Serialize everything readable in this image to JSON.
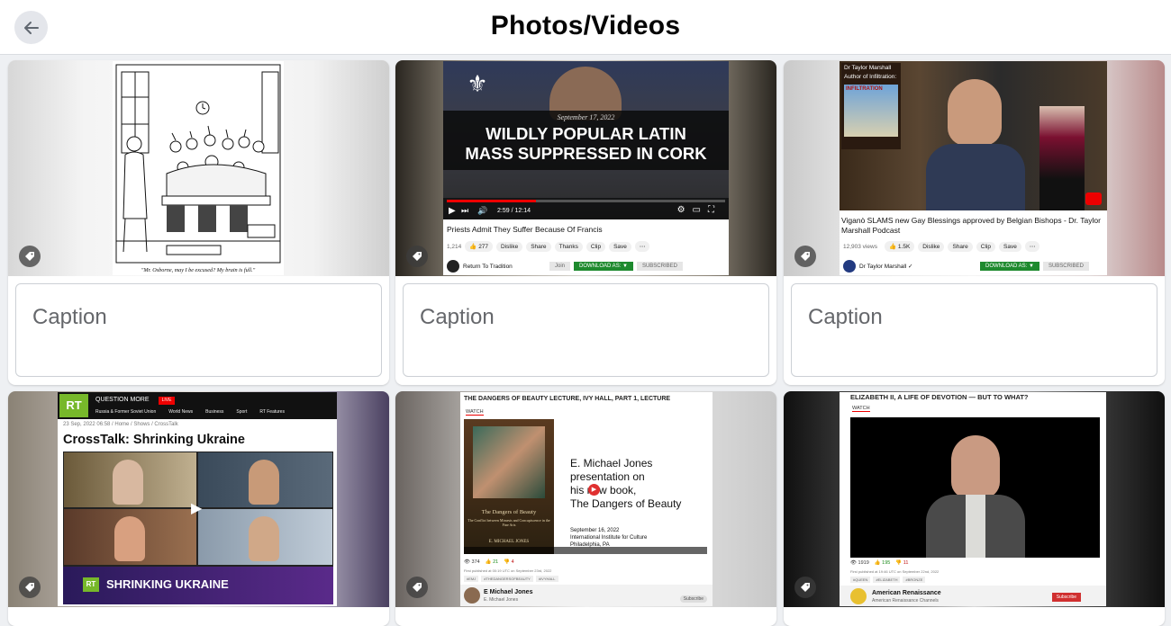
{
  "header": {
    "title": "Photos/Videos",
    "back_icon": "arrow-left-icon"
  },
  "caption_placeholder": "Caption",
  "cards": [
    {
      "cartoon_caption": "\"Mr. Osborne, may I be excused? My brain is full.\""
    },
    {
      "banner_date": "September 17, 2022",
      "banner_line1": "WILDLY POPULAR LATIN",
      "banner_line2": "MASS SUPPRESSED IN CORK",
      "time": "2:59 / 12:14",
      "video_title": "Priests Admit They Suffer Because Of Francis",
      "views": "1,214",
      "likes": "277",
      "dislike": "Dislike",
      "share": "Share",
      "thanks": "Thanks",
      "clip": "Clip",
      "save": "Save",
      "channel": "Return To Tradition",
      "join": "Join",
      "download": "DOWNLOAD AS: ▼",
      "subscribed": "SUBSCRIBED"
    },
    {
      "book_line1": "Dr Taylor Marshall",
      "book_line2": "Author of Infiltration:",
      "book_word": "INFILTRATION",
      "video_title": "Viganò SLAMS new Gay Blessings approved by Belgian Bishops - Dr. Taylor Marshall Podcast",
      "views": "12,903 views",
      "likes": "1.5K",
      "dislike": "Dislike",
      "share": "Share",
      "clip": "Clip",
      "save": "Save",
      "channel": "Dr Taylor Marshall ✓",
      "download": "DOWNLOAD AS: ▼",
      "subscribed": "SUBSCRIBED"
    },
    {
      "rt_logo": "RT",
      "question_more": "QUESTION MORE",
      "live": "LIVE",
      "nav": [
        "Russia & Former Soviet Union",
        "World News",
        "Business",
        "Sport",
        "RT Features"
      ],
      "breadcrumb": "23 Sep, 2022 06:58 / Home / Shows / CrossTalk",
      "headline": "CrossTalk: Shrinking Ukraine",
      "banner": "SHRINKING UKRAINE"
    },
    {
      "page_title": "THE DANGERS OF BEAUTY LECTURE, IVY HALL, PART 1, LECTURE",
      "watch": "WATCH",
      "book_title": "The Dangers of Beauty",
      "book_sub": "The Conflict between Mimesis and Concupiscence in the Fine Arts",
      "book_author": "E. MICHAEL JONES",
      "slide_line1": "E. Michael Jones",
      "slide_line2": "presentation on",
      "slide_line3": "his new book,",
      "slide_line4": "The Dangers of Beauty",
      "slide_date": "September 16, 2022",
      "slide_inst": "International Institute for Culture",
      "slide_city": "Philadelphia, PA",
      "stat1": "374",
      "stat2": "21",
      "stat3": "4",
      "published": "First published at 00:19 UTC on September 23rd, 2022",
      "tags": [
        "#EMJ",
        "#THEDANGERSOFBEAUTY",
        "#IVYHALL"
      ],
      "channel": "E Michael Jones",
      "channel_sub": "E. Michael Jones",
      "subscribe": "Subscribe"
    },
    {
      "page_title": "ELIZABETH II, A LIFE OF DEVOTION — BUT TO WHAT?",
      "watch": "WATCH",
      "stat1": "1919",
      "stat2": "195",
      "stat3": "11",
      "published": "First published at 19:46 UTC on September 22nd, 2022",
      "tags": [
        "#QUEEN",
        "#ELIZABETH",
        "#BRONZE"
      ],
      "channel": "American Renaissance",
      "channel_sub": "American Renaissance Channels",
      "subscribe": "Subscribe"
    }
  ],
  "colors": {
    "page_bg": "#eef0f3",
    "header_bg": "#ffffff",
    "rt_green": "#77b82a",
    "download_green": "#1e8a2e"
  }
}
